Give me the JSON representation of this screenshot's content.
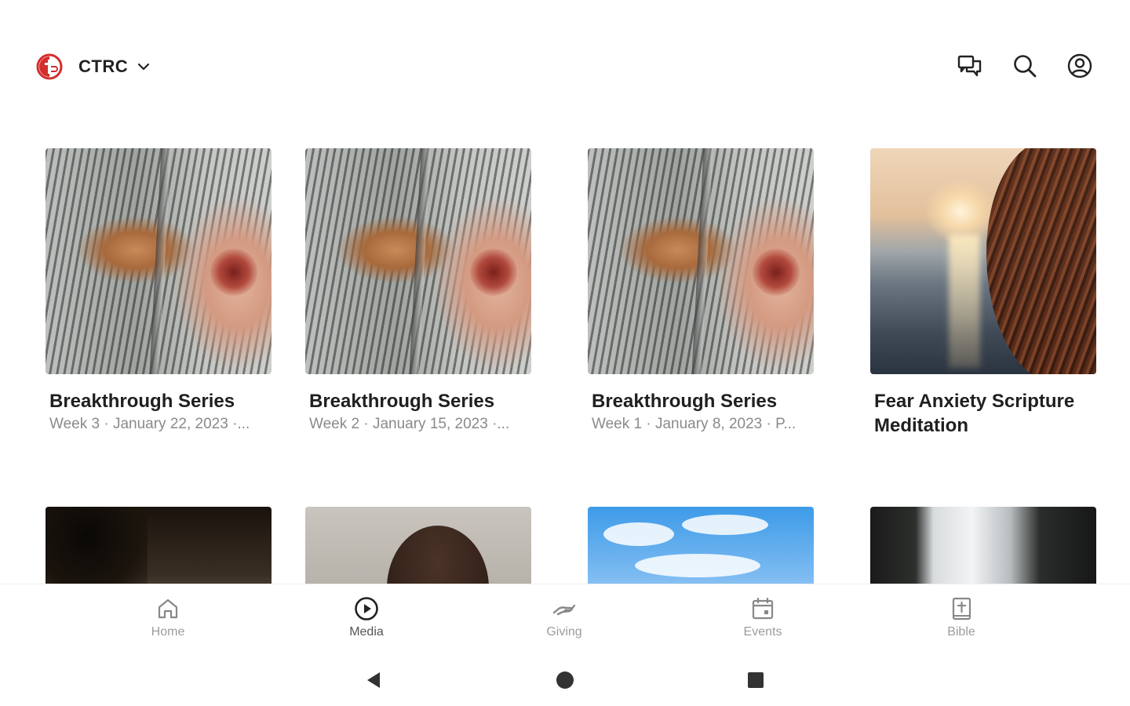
{
  "header": {
    "org_name": "CTRC",
    "logo_icon": "church-logo-icon",
    "icons": [
      "messages-icon",
      "search-icon",
      "account-icon"
    ]
  },
  "cards": [
    {
      "title": "Breakthrough Series",
      "subtitle": "Week 3 · January 22, 2023 ·..."
    },
    {
      "title": "Breakthrough Series",
      "subtitle": "Week 2 · January 15, 2023 ·..."
    },
    {
      "title": "Breakthrough Series",
      "subtitle": "Week 1 · January 8, 2023 · P..."
    },
    {
      "title": "Fear Anxiety Scripture Meditation",
      "subtitle": ""
    }
  ],
  "nav": {
    "items": [
      {
        "label": "Home",
        "icon": "home-icon"
      },
      {
        "label": "Media",
        "icon": "play-circle-icon"
      },
      {
        "label": "Giving",
        "icon": "giving-hand-icon"
      },
      {
        "label": "Events",
        "icon": "calendar-icon"
      },
      {
        "label": "Bible",
        "icon": "bible-icon"
      }
    ],
    "active": "Media"
  },
  "system_nav": [
    "back-icon",
    "home-circle-icon",
    "recents-icon"
  ],
  "colors": {
    "brand_red": "#d42d2d",
    "text_primary": "#202020",
    "text_secondary": "#8a8a8a",
    "nav_inactive": "#9c9c9c"
  }
}
